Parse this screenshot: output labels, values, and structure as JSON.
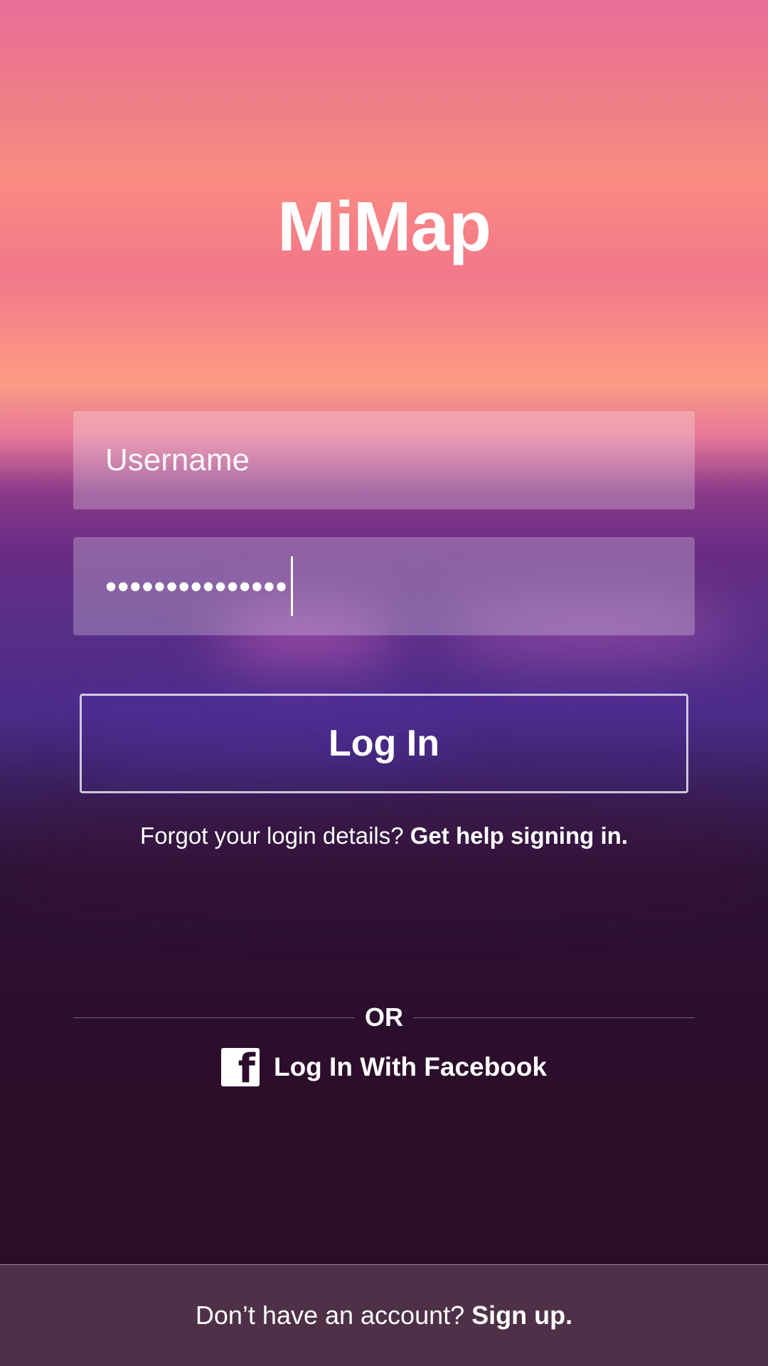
{
  "app_title": "MiMap",
  "form": {
    "username_placeholder": "Username",
    "password_mask": "•••••••••••••••"
  },
  "login_button_label": "Log In",
  "help": {
    "prompt": "Forgot your login details?",
    "link": "Get help signing in."
  },
  "divider_text": "OR",
  "facebook": {
    "icon": "facebook-icon",
    "label": "Log In With Facebook"
  },
  "footer": {
    "prompt": "Don’t have an account?",
    "link": "Sign up."
  }
}
